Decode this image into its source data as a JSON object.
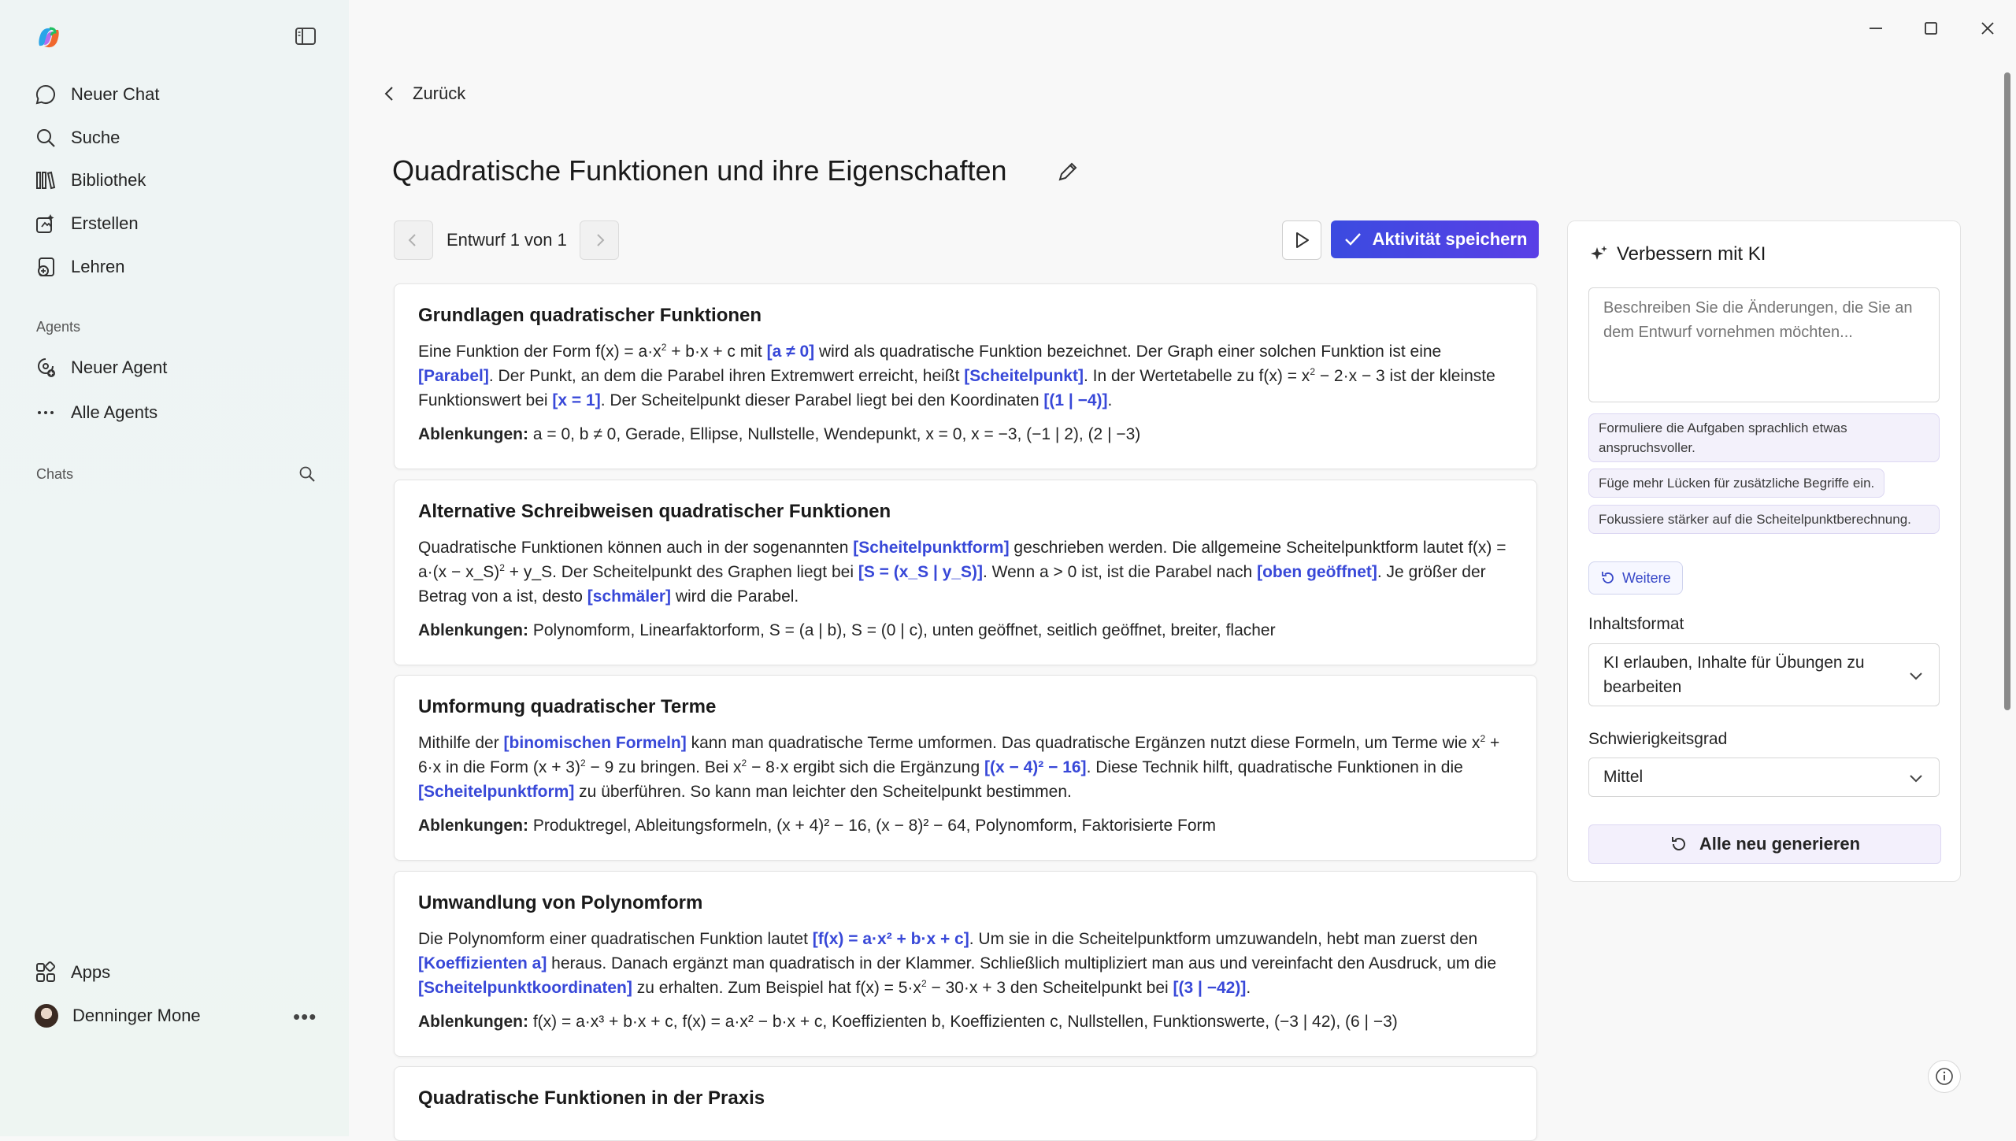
{
  "sidebar": {
    "nav": [
      {
        "label": "Neuer Chat",
        "icon": "chat-icon"
      },
      {
        "label": "Suche",
        "icon": "search-icon"
      },
      {
        "label": "Bibliothek",
        "icon": "library-icon"
      },
      {
        "label": "Erstellen",
        "icon": "create-icon"
      },
      {
        "label": "Lehren",
        "icon": "teach-icon"
      }
    ],
    "agents_section": "Agents",
    "agents": [
      {
        "label": "Neuer Agent",
        "icon": "new-agent-icon"
      },
      {
        "label": "Alle Agents",
        "icon": "more-icon"
      }
    ],
    "chats_section": "Chats",
    "apps_label": "Apps",
    "user_name": "Denninger Mone"
  },
  "header": {
    "back_label": "Zurück",
    "title": "Quadratische Funktionen und ihre Eigenschaften",
    "draft_label": "Entwurf 1 von 1",
    "save_label": "Aktivität speichern"
  },
  "cards": [
    {
      "title": "Grundlagen quadratischer Funktionen",
      "body": [
        {
          "t": "Eine Funktion der Form f(x) = a·x"
        },
        {
          "t": "2",
          "sup": true
        },
        {
          "t": " + b·x + c mit "
        },
        {
          "t": "[a ≠ 0]",
          "gap": true
        },
        {
          "t": " wird als quadratische Funktion bezeichnet. Der Graph einer solchen Funktion ist eine "
        },
        {
          "t": "[Parabel]",
          "gap": true
        },
        {
          "t": ". Der Punkt, an dem die Parabel ihren Extremwert erreicht, heißt "
        },
        {
          "t": "[Scheitelpunkt]",
          "gap": true
        },
        {
          "t": ". In der Wertetabelle zu f(x) = x"
        },
        {
          "t": "2",
          "sup": true
        },
        {
          "t": " − 2·x − 3 ist der kleinste Funktionswert bei "
        },
        {
          "t": "[x = 1]",
          "gap": true
        },
        {
          "t": ". Der Scheitelpunkt dieser Parabel liegt bei den Koordinaten "
        },
        {
          "t": "[(1 | −4)]",
          "gap": true
        },
        {
          "t": "."
        }
      ],
      "distractors_label": "Ablenkungen:",
      "distractors": "a = 0, b ≠ 0, Gerade, Ellipse, Nullstelle, Wendepunkt, x = 0, x = −3, (−1 | 2), (2 | −3)"
    },
    {
      "title": "Alternative Schreibweisen quadratischer Funktionen",
      "body": [
        {
          "t": "Quadratische Funktionen können auch in der sogenannten "
        },
        {
          "t": "[Scheitelpunktform]",
          "gap": true
        },
        {
          "t": " geschrieben werden. Die allgemeine Scheitelpunktform lautet f(x) = a·(x − x_S)"
        },
        {
          "t": "2",
          "sup": true
        },
        {
          "t": " + y_S. Der Scheitelpunkt des Graphen liegt bei "
        },
        {
          "t": "[S = (x_S | y_S)]",
          "gap": true
        },
        {
          "t": ". Wenn a > 0 ist, ist die Parabel nach "
        },
        {
          "t": "[oben geöffnet]",
          "gap": true
        },
        {
          "t": ". Je größer der Betrag von a ist, desto "
        },
        {
          "t": "[schmäler]",
          "gap": true
        },
        {
          "t": " wird die Parabel."
        }
      ],
      "distractors_label": "Ablenkungen:",
      "distractors": "Polynomform, Linearfaktorform, S = (a | b), S = (0 | c), unten geöffnet, seitlich geöffnet, breiter, flacher"
    },
    {
      "title": "Umformung quadratischer Terme",
      "body": [
        {
          "t": "Mithilfe der "
        },
        {
          "t": "[binomischen Formeln]",
          "gap": true
        },
        {
          "t": " kann man quadratische Terme umformen. Das quadratische Ergänzen nutzt diese Formeln, um Terme wie x"
        },
        {
          "t": "2",
          "sup": true
        },
        {
          "t": " + 6·x in die Form (x + 3)"
        },
        {
          "t": "2",
          "sup": true
        },
        {
          "t": " − 9 zu bringen. Bei x"
        },
        {
          "t": "2",
          "sup": true
        },
        {
          "t": " − 8·x ergibt sich die Ergänzung "
        },
        {
          "t": "[(x − 4)² − 16]",
          "gap": true
        },
        {
          "t": ". Diese Technik hilft, quadratische Funktionen in die "
        },
        {
          "t": "[Scheitelpunktform]",
          "gap": true
        },
        {
          "t": " zu überführen. So kann man leichter den Scheitelpunkt bestimmen."
        }
      ],
      "distractors_label": "Ablenkungen:",
      "distractors": "Produktregel, Ableitungsformeln, (x + 4)² − 16, (x − 8)² − 64, Polynomform, Faktorisierte Form"
    },
    {
      "title": "Umwandlung von Polynomform",
      "body": [
        {
          "t": "Die Polynomform einer quadratischen Funktion lautet "
        },
        {
          "t": "[f(x) = a·x² + b·x + c]",
          "gap": true
        },
        {
          "t": ". Um sie in die Scheitelpunktform umzuwandeln, hebt man zuerst den "
        },
        {
          "t": "[Koeffizienten a]",
          "gap": true
        },
        {
          "t": " heraus. Danach ergänzt man quadratisch in der Klammer. Schließlich multipliziert man aus und vereinfacht den Ausdruck, um die "
        },
        {
          "t": "[Scheitelpunktkoordinaten]",
          "gap": true
        },
        {
          "t": " zu erhalten. Zum Beispiel hat f(x) = 5·x"
        },
        {
          "t": "2",
          "sup": true
        },
        {
          "t": " − 30·x + 3 den Scheitelpunkt bei "
        },
        {
          "t": "[(3 | −42)]",
          "gap": true
        },
        {
          "t": "."
        }
      ],
      "distractors_label": "Ablenkungen:",
      "distractors": "f(x) = a·x³ + b·x + c, f(x) = a·x² − b·x + c, Koeffizienten b, Koeffizienten c, Nullstellen, Funktionswerte, (−3 | 42), (6 | −3)"
    },
    {
      "title": "Quadratische Funktionen in der Praxis",
      "body": [],
      "distractors_label": "",
      "distractors": ""
    }
  ],
  "panel": {
    "title": "Verbessern mit KI",
    "input_placeholder": "Beschreiben Sie die Änderungen, die Sie an dem Entwurf vornehmen möchten...",
    "suggestions": [
      "Formuliere die Aufgaben sprachlich etwas anspruchsvoller.",
      "Füge mehr Lücken für zusätzliche Begriffe ein.",
      "Fokussiere stärker auf die Scheitelpunktberechnung."
    ],
    "more_label": "Weitere",
    "content_format_label": "Inhaltsformat",
    "content_format_value": "KI erlauben, Inhalte für Übungen zu bearbeiten",
    "difficulty_label": "Schwierigkeitsgrad",
    "difficulty_value": "Mittel",
    "regenerate_label": "Alle neu generieren"
  },
  "colors": {
    "accent": "#3848d8",
    "save_button": "#4a45e3"
  }
}
